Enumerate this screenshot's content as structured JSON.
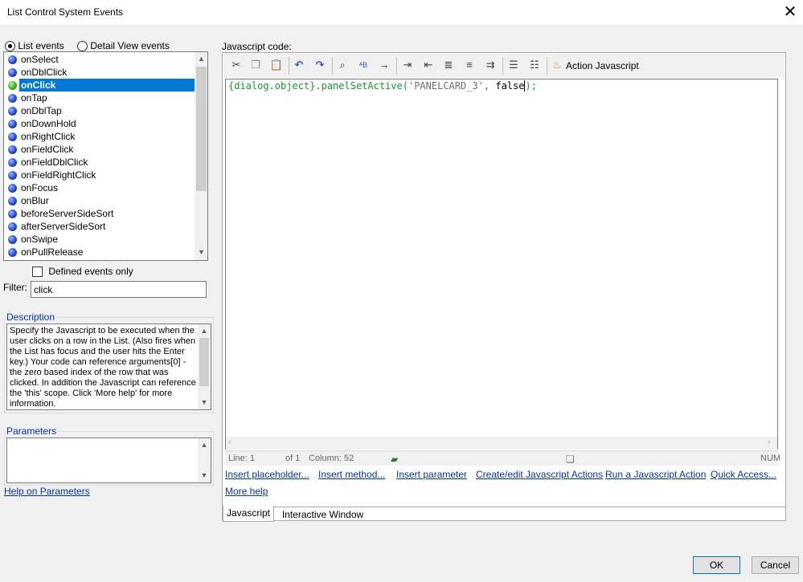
{
  "window": {
    "title": "List Control System Events",
    "close_glyph": "✕"
  },
  "view_toggle": {
    "list_events": "List events",
    "detail_view_events": "Detail View events"
  },
  "event_list": {
    "items": [
      {
        "label": "onSelect",
        "dot": "blue"
      },
      {
        "label": "onDblClick",
        "dot": "blue"
      },
      {
        "label": "onClick",
        "dot": "green",
        "selected": true
      },
      {
        "label": "onTap",
        "dot": "blue"
      },
      {
        "label": "onDblTap",
        "dot": "blue"
      },
      {
        "label": "onDownHold",
        "dot": "blue"
      },
      {
        "label": "onRightClick",
        "dot": "blue"
      },
      {
        "label": "onFieldClick",
        "dot": "blue"
      },
      {
        "label": "onFieldDblClick",
        "dot": "blue"
      },
      {
        "label": "onFieldRightClick",
        "dot": "blue"
      },
      {
        "label": "onFocus",
        "dot": "blue"
      },
      {
        "label": "onBlur",
        "dot": "blue"
      },
      {
        "label": "beforeServerSideSort",
        "dot": "blue"
      },
      {
        "label": "afterServerSideSort",
        "dot": "blue"
      },
      {
        "label": "onSwipe",
        "dot": "blue"
      },
      {
        "label": "onPullRelease",
        "dot": "blue"
      }
    ]
  },
  "defined_events_only": "Defined events only",
  "filter": {
    "label": "Filter:",
    "value": "click"
  },
  "description": {
    "title": "Description",
    "lines": [
      "Specify the Javascript to be executed when the",
      "user clicks on a row in the List. (Also fires when",
      "the List has focus and the user hits the Enter",
      "key.)  Your code can reference arguments[0]  -",
      "the zero based index of the row that was",
      "clicked. In addition the Javascript can reference",
      "the 'this' scope. Click 'More help' for more",
      "information."
    ]
  },
  "parameters": {
    "title": "Parameters",
    "help_link": "Help on Parameters"
  },
  "editor": {
    "label": "Javascript code:",
    "action_javascript": "Action Javascript",
    "code": {
      "placeholder": "{dialog.object}",
      "method": ".panelSetActive(",
      "string": "'PANELCARD_3'",
      "comma": ", ",
      "keyword": "false",
      "end": ");"
    }
  },
  "toolbar_icons": [
    "cut-icon",
    "copy-icon",
    "paste-icon",
    "undo-icon",
    "redo-icon",
    "find-icon",
    "replace-icon",
    "goto-icon",
    "indent-icon",
    "outdent-icon",
    "comment-icon",
    "uncomment-icon",
    "wrap-icon",
    "bullet-list-icon",
    "numbered-list-icon",
    "lamp-icon"
  ],
  "status": {
    "line": "Line: 1",
    "of": "of 1",
    "column": "Column: 52",
    "num": "NUM"
  },
  "links": {
    "insert_placeholder": "Insert placeholder...",
    "insert_method": "Insert method...",
    "insert_parameter": "Insert parameter",
    "create_edit": "Create/edit Javascript Actions",
    "run_action": "Run a Javascript Action",
    "quick_access": "Quick Access...",
    "more_help": "More help"
  },
  "tabs": {
    "javascript": "Javascript",
    "interactive": "Interactive Window"
  },
  "buttons": {
    "ok": "OK",
    "cancel": "Cancel"
  }
}
